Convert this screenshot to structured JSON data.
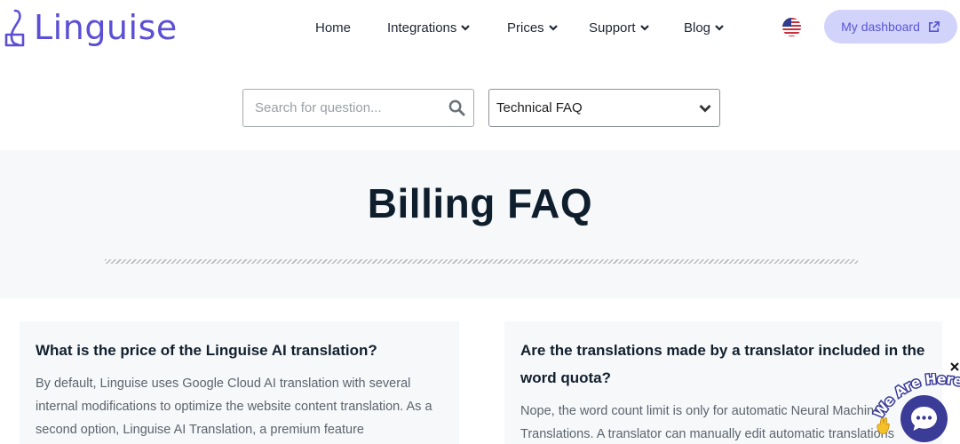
{
  "brand": {
    "name": "Linguise",
    "color": "#5b4fd6"
  },
  "nav": {
    "items": [
      {
        "label": "Home",
        "dropdown": false
      },
      {
        "label": "Integrations",
        "dropdown": true
      },
      {
        "label": "Prices",
        "dropdown": true
      },
      {
        "label": "Support",
        "dropdown": true
      },
      {
        "label": "Blog",
        "dropdown": true
      }
    ],
    "language_icon": "us-flag-icon",
    "dashboard_label": "My dashboard",
    "dashboard_icon": "external-link-icon"
  },
  "search": {
    "placeholder": "Search for question...",
    "value": "",
    "category_selected": "Technical FAQ"
  },
  "hero": {
    "title": "Billing FAQ"
  },
  "faq": [
    {
      "question": "What is the price of the Linguise AI translation?",
      "answer": "By default, Linguise uses Google Cloud AI translation with several internal modifications to optimize the website content translation. As a second option, Linguise AI Translation, a premium feature"
    },
    {
      "question": "Are the translations made by a translator included in the word quota?",
      "answer": "Nope, the word count limit is only for automatic Neural Machine Translations. A translator can manually edit automatic translations"
    }
  ],
  "chat": {
    "label": "We Are Here!",
    "accent": "#3b3c98"
  },
  "colors": {
    "accent": "#5756d6",
    "button_bg": "#d2d3fb",
    "band_bg": "#f6f8fa",
    "title": "#0e1e2c"
  }
}
